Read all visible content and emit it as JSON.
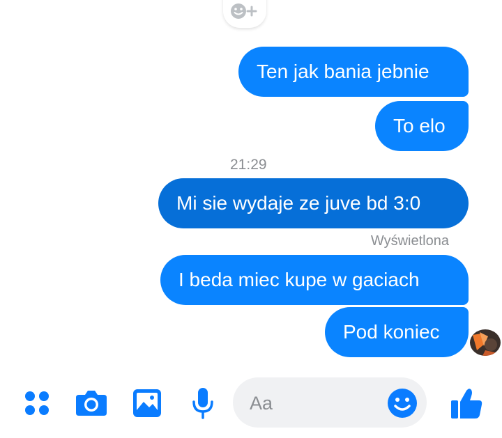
{
  "thread": {
    "messages": [
      {
        "text": "Ten jak bania jebnie"
      },
      {
        "text": "To elo"
      },
      {
        "text": "Mi sie wydaje ze juve bd 3:0"
      },
      {
        "text": "I beda miec kupe w gaciach"
      },
      {
        "text": "Pod koniec"
      }
    ],
    "timestamp": "21:29",
    "seen_label": "Wyświetlona"
  },
  "composer": {
    "placeholder": "Aa",
    "icons": [
      "apps-icon",
      "camera-icon",
      "gallery-icon",
      "microphone-icon",
      "emoji-icon",
      "thumbs-up-icon"
    ]
  },
  "colors": {
    "bubble": "#0a84ff",
    "bubble_dark": "#066fd8",
    "accent": "#0a7cff",
    "muted_text": "#8a8d91",
    "input_bg": "#f0f1f3"
  }
}
